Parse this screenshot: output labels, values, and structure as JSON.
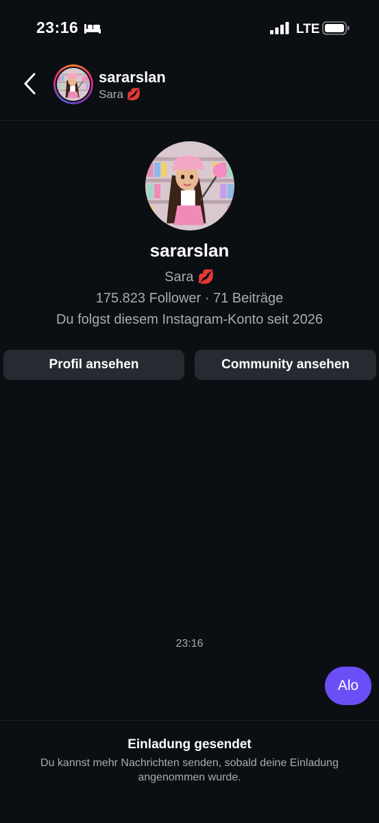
{
  "status_bar": {
    "time": "23:16",
    "network": "LTE",
    "icons": [
      "bed-icon",
      "signal-icon",
      "battery-icon"
    ]
  },
  "header": {
    "back_icon": "chevron-left-icon",
    "username": "sararslan",
    "display_name": "Sara 💋"
  },
  "profile": {
    "username": "sararslan",
    "display_name": "Sara 💋",
    "stats": "175.823 Follower · 71 Beiträge",
    "follow_info": "Du folgst diesem Instagram-Konto seit 2026",
    "buttons": {
      "view_profile": "Profil ansehen",
      "view_community": "Community ansehen"
    }
  },
  "chat": {
    "timestamp": "23:16",
    "messages": [
      {
        "text": "Alo",
        "sender": "me"
      }
    ]
  },
  "footer": {
    "title": "Einladung gesendet",
    "text": "Du kannst mehr Nachrichten senden, sobald deine Einladung angenommen wurde."
  },
  "colors": {
    "background": "#0b0e13",
    "button": "#262a31",
    "bubble": "#6b4ef6",
    "secondary_text": "#a8acb3"
  }
}
